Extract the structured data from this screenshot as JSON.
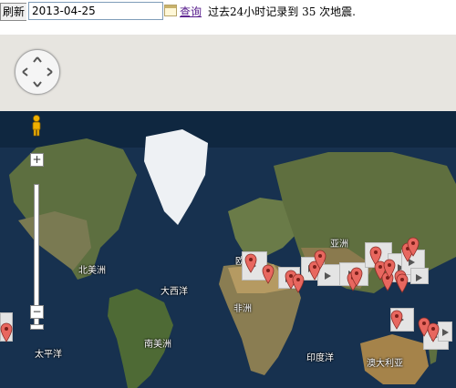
{
  "toolbar": {
    "refresh_label": "刷新",
    "date_value": "2013-04-25",
    "calendar_icon": "calendar-icon",
    "query_label": "查询",
    "status_text": "过去24小时记录到  35 次地震."
  },
  "map": {
    "labels": [
      {
        "text": "北美洲"
      },
      {
        "text": "大西洋"
      },
      {
        "text": "非洲"
      },
      {
        "text": "亚洲"
      },
      {
        "text": "欧"
      },
      {
        "text": "南美洲"
      },
      {
        "text": "太平洋"
      },
      {
        "text": "印度洋"
      },
      {
        "text": "澳大利亚"
      }
    ],
    "controls": {
      "pan_icon": "pan-control-icon",
      "zoom_in_label": "+",
      "zoom_out_label": "−",
      "street_view_icon": "pegman-icon"
    },
    "markers_shown": "earthquake-marker-icon",
    "colors": {
      "marker": "#e8675f",
      "ocean": "#1a3a5c",
      "land": "#6b7d4a",
      "map_bg": "#e7e5e0"
    }
  }
}
